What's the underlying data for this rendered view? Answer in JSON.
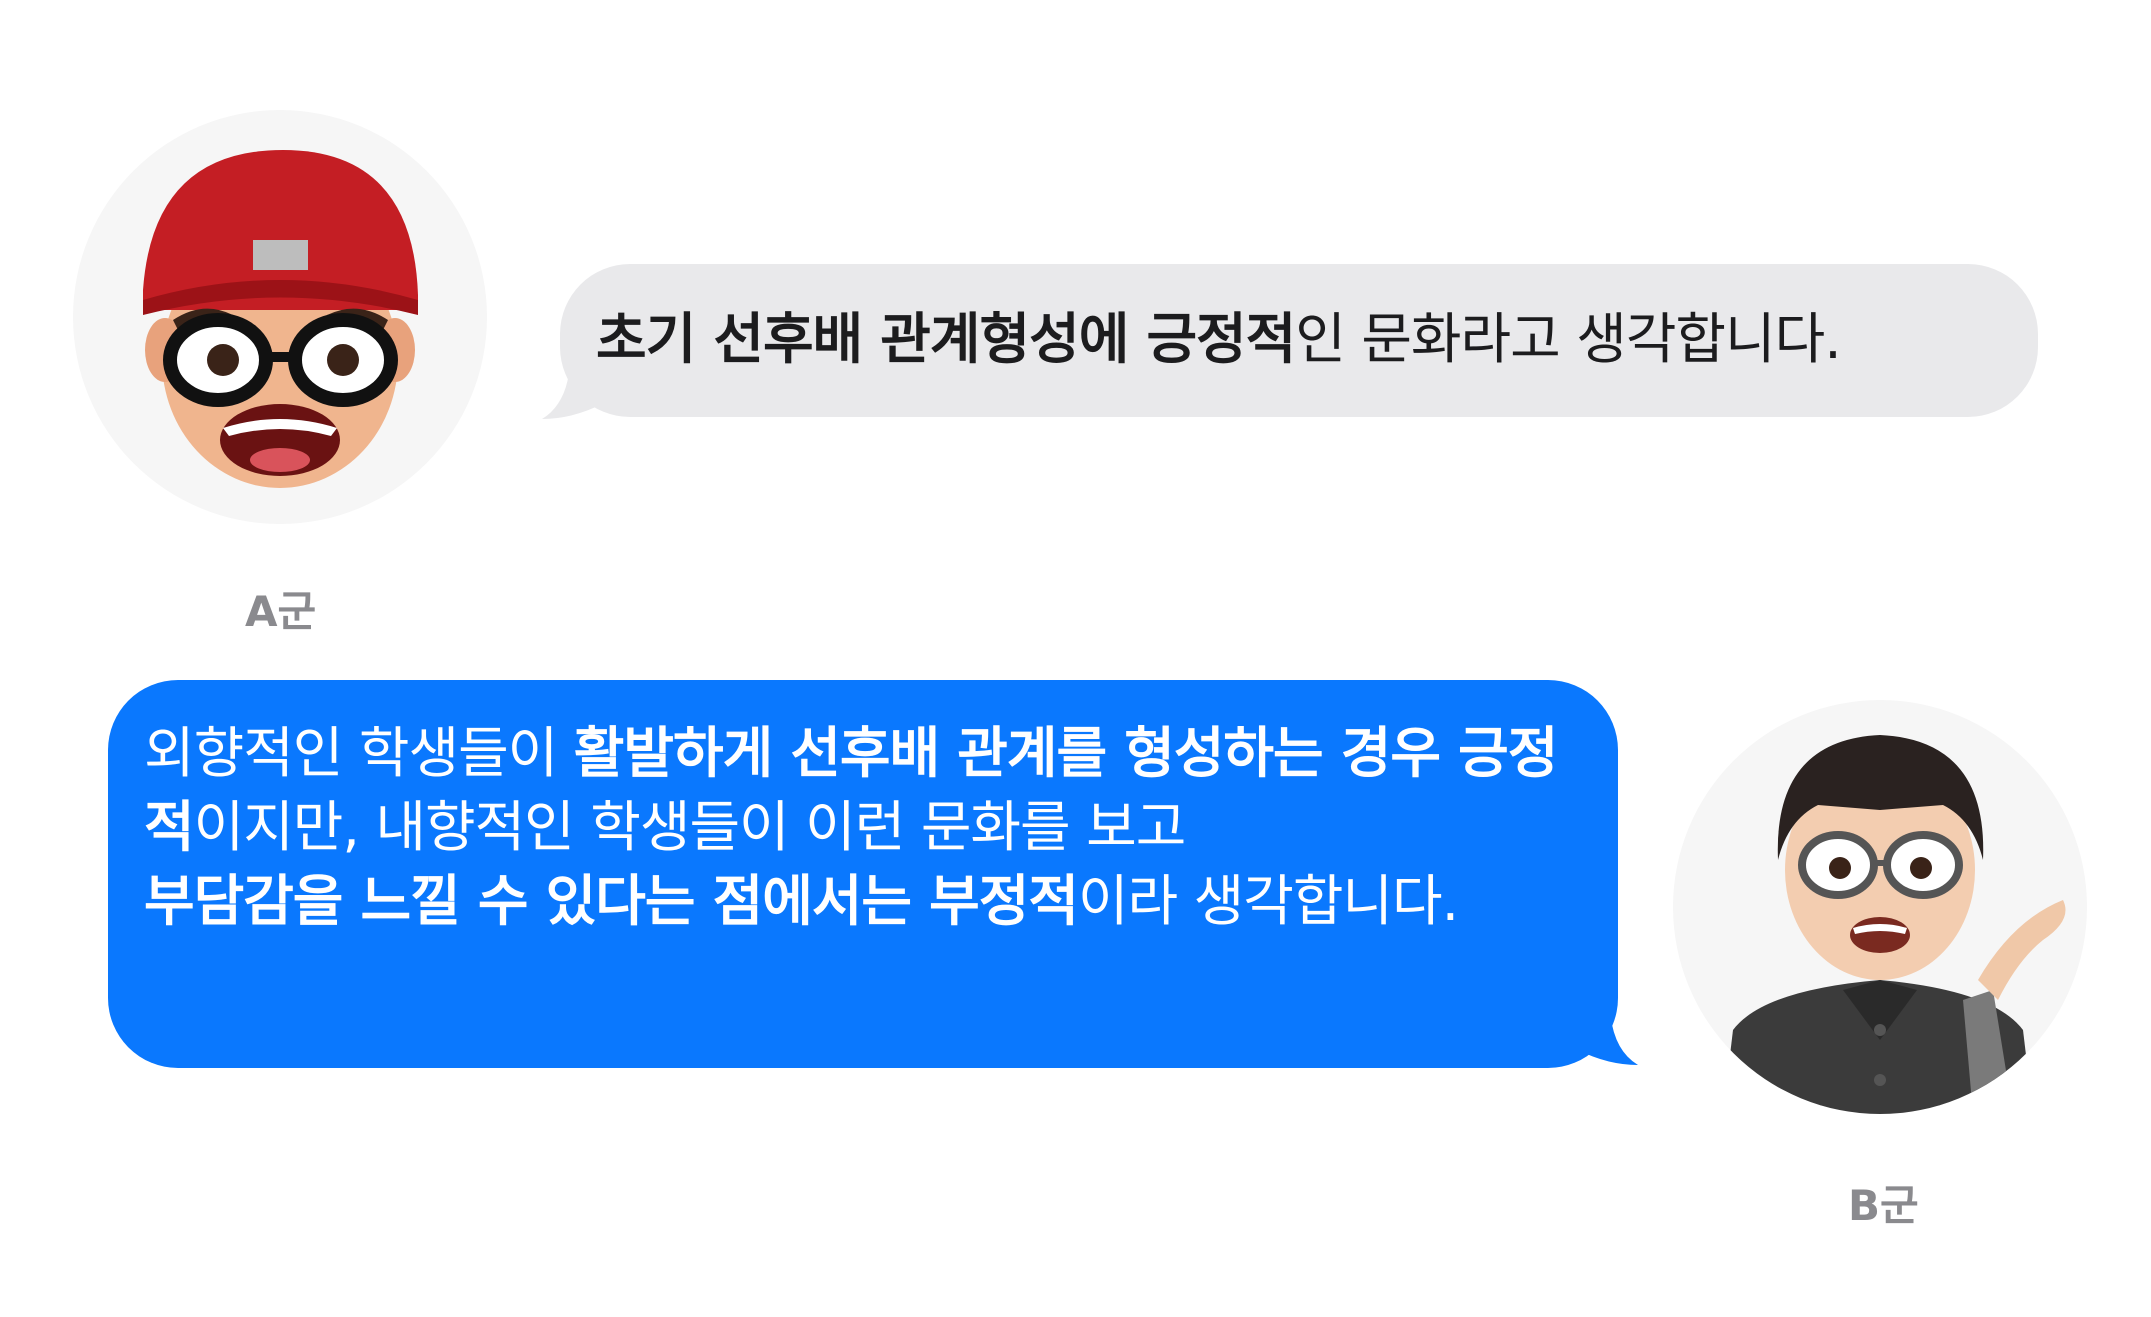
{
  "participants": {
    "a": {
      "name": "A군",
      "avatar": "memoji-red-cap-glasses"
    },
    "b": {
      "name": "B군",
      "avatar": "memoji-glasses-hand-gesture"
    }
  },
  "colors": {
    "incoming_bubble": "#e9e9eb",
    "outgoing_bubble": "#0a78fe",
    "name_label": "#8a8a8e"
  },
  "messages": [
    {
      "sender": "A군",
      "segments": [
        {
          "text": "초기 선후배 관계형성에 긍정적",
          "bold": true
        },
        {
          "text": "인 문화라고 생각합니다.",
          "bold": false
        }
      ]
    },
    {
      "sender": "B군",
      "segments": [
        {
          "text": "외향적인 학생들이 ",
          "bold": false
        },
        {
          "text": "활발하게 선후배 관계를 형성하는 경우 긍정적",
          "bold": true
        },
        {
          "text": "이지만, 내향적인 학생들이 이런 문화를 보고 ",
          "bold": false
        },
        {
          "text": "부담감을 느낄 수 있다는 점에서는 부정적",
          "bold": true
        },
        {
          "text": "이라 생각합니다.",
          "bold": false
        }
      ]
    }
  ]
}
